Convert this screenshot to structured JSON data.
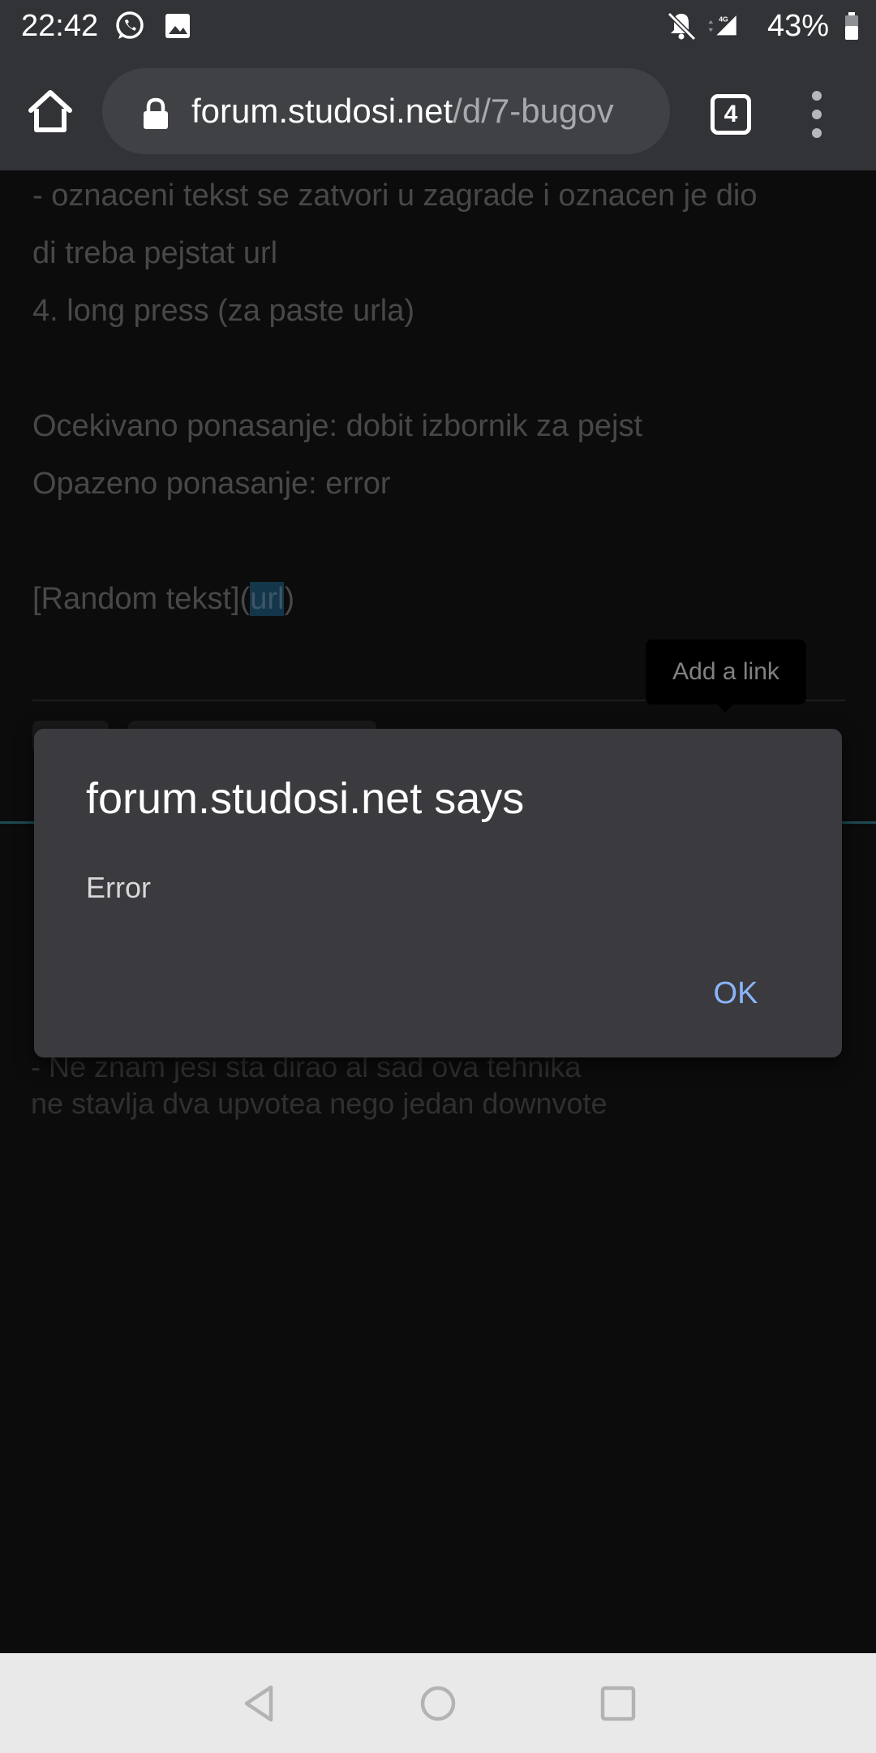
{
  "status_bar": {
    "time": "22:42",
    "network": "4G",
    "battery": "43%",
    "icons": [
      "whatsapp-icon",
      "image-icon",
      "bell-off-icon",
      "signal-icon",
      "battery-icon"
    ]
  },
  "browser": {
    "url_domain": "forum.studosi.net",
    "url_path": "/d/7-bugov",
    "tab_count": "4",
    "icons": [
      "home-icon",
      "lock-icon",
      "more-vert-icon"
    ]
  },
  "page": {
    "lines": [
      "  - oznaceni tekst se zatvori u zagrade i oznacen je dio",
      "di treba pejstat url",
      "4. long press (za paste urla)",
      "Ocekivano ponasanje: dobit izbornik za pejst",
      "Opazeno ponasanje: error"
    ],
    "markdown_prefix": "[Random tekst](",
    "markdown_selected": "url",
    "markdown_suffix": ")",
    "tooltip": "Add a link",
    "below_lines": [
      "- Ne znam jesi sta dirao al sad ova tehnika",
      "ne stavlja dva upvotea nego jedan downvote"
    ]
  },
  "dialog": {
    "title": "forum.studosi.net says",
    "message": "Error",
    "ok_label": "OK"
  },
  "colors": {
    "accent": "#8ab4f8",
    "toolbar": "#323337",
    "dialog": "#3a3a3f"
  }
}
